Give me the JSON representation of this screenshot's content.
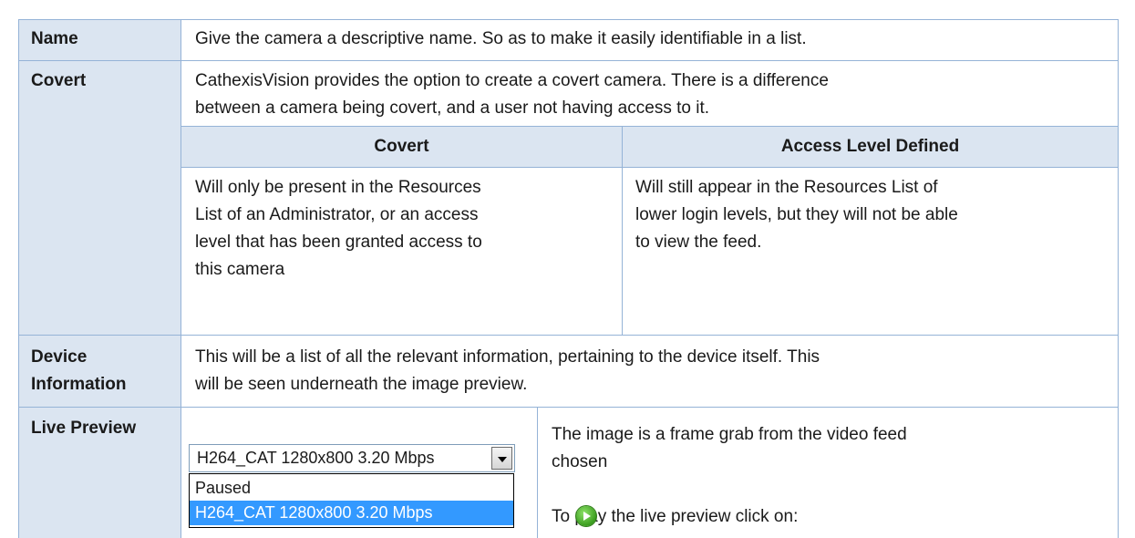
{
  "rows": {
    "name": {
      "label": "Name",
      "text": "Give the camera a descriptive name. So as to make it easily identifiable in a list."
    },
    "covert": {
      "label": "Covert",
      "text_line1": "CathexisVision provides the option to create a covert camera. There is a difference",
      "text_line2": "between a camera being covert, and a user not having access to it.",
      "subtable": {
        "headers": [
          "Covert",
          "Access Level Defined"
        ],
        "col1_lines": [
          "Will only be present in the Resources",
          "List of an Administrator, or an access",
          "level that has been granted access to",
          "this camera"
        ],
        "col2_lines": [
          "Will still appear in the Resources List of",
          "lower login levels, but they will not be able",
          "to view the feed."
        ]
      }
    },
    "device_information": {
      "label_line1": "Device",
      "label_line2": "Information",
      "text_line1": "This will be a list of all the relevant information, pertaining to the device itself. This",
      "text_line2": "will be seen underneath the image preview."
    },
    "live_preview": {
      "label": "Live Preview",
      "dropdown": {
        "selected": "H264_CAT 1280x800 3.20 Mbps",
        "options": [
          "Paused",
          "H264_CAT 1280x800 3.20 Mbps"
        ]
      },
      "text_line1": "The image is a frame grab from the video feed",
      "text_line2": "chosen",
      "play_text": "To play the live preview click on:",
      "play_icon": "play-icon"
    }
  }
}
